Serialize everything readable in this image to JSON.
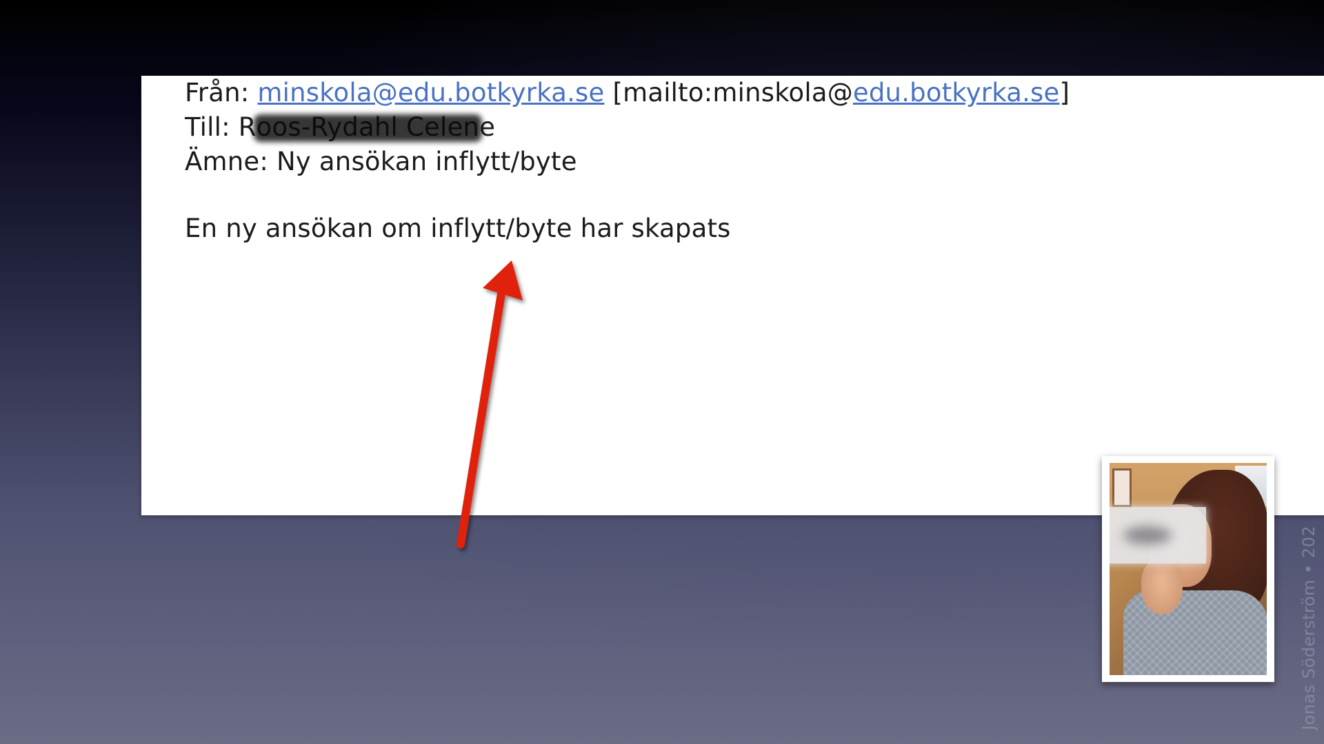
{
  "email": {
    "from_label": "Från: ",
    "from_address": "minskola@edu.botkyrka.se",
    "mailto_prefix": "[mailto:minskola@",
    "mailto_domain": "edu.botkyrka.se",
    "mailto_suffix": "]",
    "to_label": "Till: ",
    "to_name_first": "R",
    "to_name_redacted": "oos-Rydahl Celen",
    "to_name_last": "e",
    "subject_label": "Ämne: ",
    "subject": "Ny ansökan inflytt/byte",
    "body": "En ny ansökan om inflytt/byte har skapats"
  },
  "annotation": {
    "arrow_color": "#e0220f",
    "arrow_icon": "arrow-up-icon"
  },
  "photo": {
    "description_icon": "person-photo-icon"
  },
  "watermark": {
    "text": "Jonas Söderström • 202"
  },
  "colors": {
    "link": "#4a72c4",
    "text": "#1b1b1b"
  }
}
